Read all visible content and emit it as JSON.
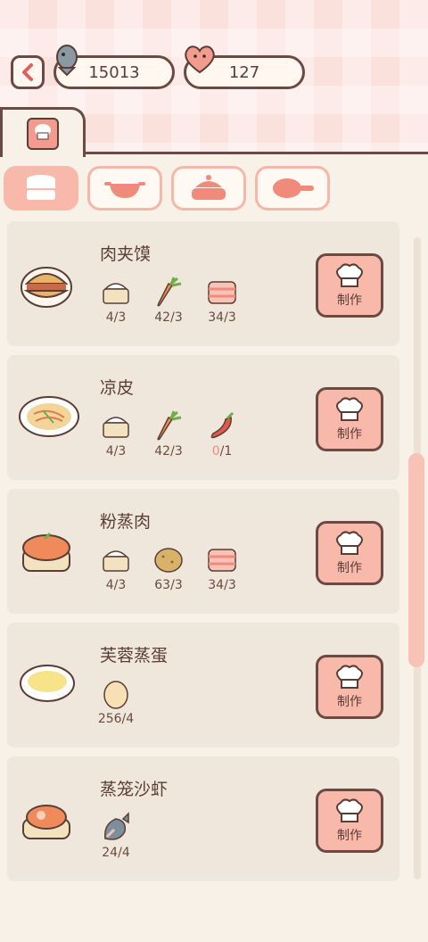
{
  "header": {
    "fish_count": "15013",
    "heart_count": "127",
    "back_icon": "chevron-left-icon"
  },
  "tabs": [
    {
      "icon": "recipe-book-icon",
      "active": true
    }
  ],
  "categories": [
    {
      "icon": "steamer-icon",
      "active": true
    },
    {
      "icon": "wok-icon",
      "active": false
    },
    {
      "icon": "pot-icon",
      "active": false
    },
    {
      "icon": "frying-pan-icon",
      "active": false
    }
  ],
  "recipes": [
    {
      "name": "肉夹馍",
      "dish_icon": "roujiamo-icon",
      "ingredients": [
        {
          "icon": "flour-icon",
          "have": "4",
          "need": "3"
        },
        {
          "icon": "carrot-icon",
          "have": "42",
          "need": "3"
        },
        {
          "icon": "meat-icon",
          "have": "34",
          "need": "3"
        }
      ],
      "button_label": "制作"
    },
    {
      "name": "凉皮",
      "dish_icon": "liangpi-icon",
      "ingredients": [
        {
          "icon": "flour-icon",
          "have": "4",
          "need": "3"
        },
        {
          "icon": "carrot-icon",
          "have": "42",
          "need": "3"
        },
        {
          "icon": "chili-icon",
          "have": "0",
          "need": "1"
        }
      ],
      "button_label": "制作"
    },
    {
      "name": "粉蒸肉",
      "dish_icon": "fenzhengrou-icon",
      "ingredients": [
        {
          "icon": "flour-icon",
          "have": "4",
          "need": "3"
        },
        {
          "icon": "potato-icon",
          "have": "63",
          "need": "3"
        },
        {
          "icon": "meat-icon",
          "have": "34",
          "need": "3"
        }
      ],
      "button_label": "制作"
    },
    {
      "name": "芙蓉蒸蛋",
      "dish_icon": "steamed-egg-icon",
      "ingredients": [
        {
          "icon": "egg-icon",
          "have": "256",
          "need": "4"
        }
      ],
      "button_label": "制作"
    },
    {
      "name": "蒸笼沙虾",
      "dish_icon": "steamed-shrimp-icon",
      "ingredients": [
        {
          "icon": "fish-icon",
          "have": "24",
          "need": "4"
        }
      ],
      "button_label": "制作"
    }
  ],
  "colors": {
    "accent": "#f8b9ab",
    "outline": "#6a4a42",
    "card": "#efe7db",
    "lack": "#f08a7a"
  }
}
